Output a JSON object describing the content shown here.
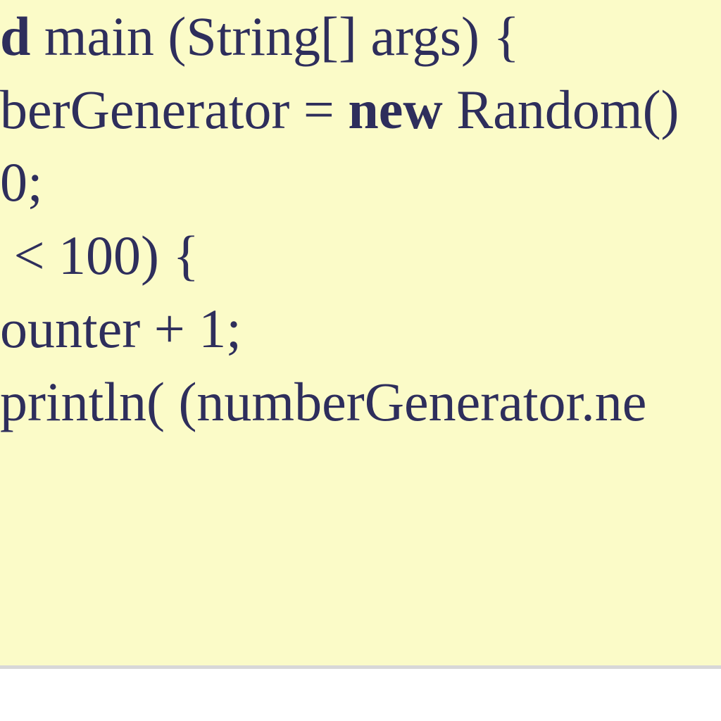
{
  "code": {
    "line1": {
      "pre_kw": "d",
      "rest": " main (String[] args) {"
    },
    "line2": {
      "pre": "berGenerator = ",
      "kw": "new",
      "post": " Random()"
    },
    "line3": "0;",
    "line4": " < 100) {",
    "line5": "ounter + 1;",
    "line6": "println( (numberGenerator.ne"
  },
  "colors": {
    "background": "#fbfbc8",
    "text": "#2e2e5c",
    "page_bg": "#ffffff",
    "divider": "#d8d8d8"
  }
}
